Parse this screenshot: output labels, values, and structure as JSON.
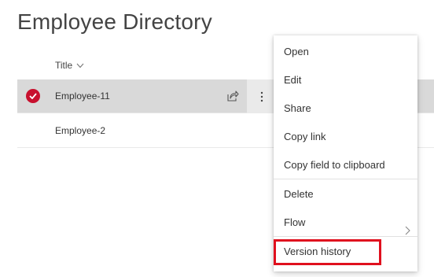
{
  "page": {
    "title": "Employee Directory"
  },
  "list": {
    "column_header": "Title",
    "rows": [
      {
        "title": "Employee-11",
        "selected": true
      },
      {
        "title": "Employee-2",
        "selected": false
      }
    ]
  },
  "context_menu": {
    "items": [
      {
        "label": "Open"
      },
      {
        "label": "Edit"
      },
      {
        "label": "Share"
      },
      {
        "label": "Copy link"
      },
      {
        "label": "Copy field to clipboard"
      },
      {
        "label": "Delete"
      },
      {
        "label": "Flow",
        "has_submenu": true
      },
      {
        "label": "Version history",
        "highlighted": true
      }
    ]
  },
  "colors": {
    "selected_check": "#c8102e",
    "highlight_border": "#e0101e",
    "selected_row_bg": "#d9d9d9"
  },
  "icons": {
    "column_sort": "chevron-down-icon",
    "row_check": "checkmark-icon",
    "row_share": "share-icon",
    "row_more": "more-vertical-icon",
    "submenu": "chevron-right-icon"
  }
}
